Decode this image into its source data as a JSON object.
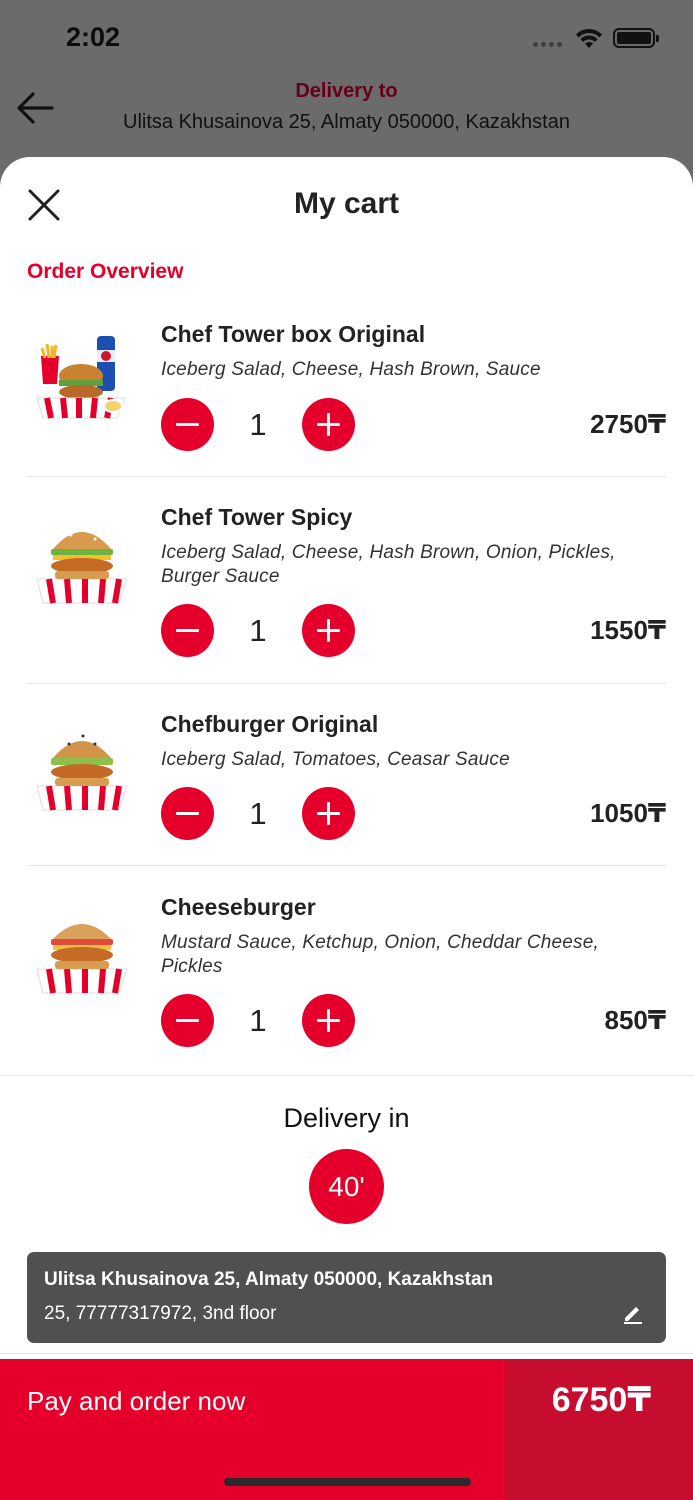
{
  "status_bar": {
    "time": "2:02"
  },
  "header": {
    "label": "Delivery to",
    "address": "Ulitsa Khusainova 25, Almaty 050000, Kazakhstan"
  },
  "cart": {
    "title": "My cart",
    "section_title": "Order Overview",
    "items": [
      {
        "name": "Chef Tower box Original",
        "description": "Iceberg Salad, Cheese, Hash Brown, Sauce",
        "quantity": "1",
        "price": "2750₸",
        "image_icon": "combo-box-meal-icon"
      },
      {
        "name": "Chef Tower Spicy",
        "description": "Iceberg Salad, Cheese, Hash Brown, Onion, Pickles, Burger Sauce",
        "quantity": "1",
        "price": "1550₸",
        "image_icon": "burger-icon"
      },
      {
        "name": "Chefburger Original",
        "description": "Iceberg Salad, Tomatoes, Ceasar Sauce",
        "quantity": "1",
        "price": "1050₸",
        "image_icon": "burger-icon"
      },
      {
        "name": "Cheeseburger",
        "description": "Mustard Sauce, Ketchup, Onion, Cheddar Cheese, Pickles",
        "quantity": "1",
        "price": "850₸",
        "image_icon": "burger-icon"
      }
    ]
  },
  "delivery": {
    "label": "Delivery in",
    "eta": "40'",
    "address_line": "Ulitsa Khusainova 25, Almaty 050000, Kazakhstan",
    "address_details": "25, 77777317972, 3nd floor"
  },
  "checkout": {
    "label": "Pay and order now",
    "total": "6750₸"
  },
  "colors": {
    "accent": "#e4002b",
    "accent_dark": "#c70d2f",
    "overlay": "#6b6b6b",
    "card": "#505050"
  }
}
